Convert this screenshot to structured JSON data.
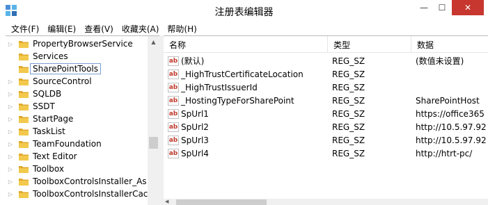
{
  "window": {
    "title": "注册表编辑器",
    "app_icon": "registry-editor-icon",
    "controls": {
      "minimize": "—",
      "maximize": "☐",
      "close": "✕"
    }
  },
  "menu": [
    "文件(F)",
    "编辑(E)",
    "查看(V)",
    "收藏夹(A)",
    "帮助(H)"
  ],
  "tree": {
    "items": [
      {
        "label": "PropertyBrowserService",
        "expandable": true,
        "selected": false
      },
      {
        "label": "Services",
        "expandable": false,
        "selected": false
      },
      {
        "label": "SharePointTools",
        "expandable": false,
        "selected": true
      },
      {
        "label": "SourceControl",
        "expandable": true,
        "selected": false
      },
      {
        "label": "SQLDB",
        "expandable": true,
        "selected": false
      },
      {
        "label": "SSDT",
        "expandable": true,
        "selected": false
      },
      {
        "label": "StartPage",
        "expandable": true,
        "selected": false
      },
      {
        "label": "TaskList",
        "expandable": true,
        "selected": false
      },
      {
        "label": "TeamFoundation",
        "expandable": true,
        "selected": false
      },
      {
        "label": "Text Editor",
        "expandable": true,
        "selected": false
      },
      {
        "label": "Toolbox",
        "expandable": true,
        "selected": false
      },
      {
        "label": "ToolboxControlsInstaller_As",
        "expandable": true,
        "selected": false
      },
      {
        "label": "ToolboxControlsInstallerCac",
        "expandable": true,
        "selected": false
      }
    ]
  },
  "list": {
    "columns": [
      "名称",
      "类型",
      "数据"
    ],
    "value_icon": "string-value-icon",
    "icon_text": "ab",
    "rows": [
      {
        "name": "(默认)",
        "type": "REG_SZ",
        "data": "(数值未设置)"
      },
      {
        "name": "_HighTrustCertificateLocation",
        "type": "REG_SZ",
        "data": ""
      },
      {
        "name": "_HighTrustIssuerId",
        "type": "REG_SZ",
        "data": ""
      },
      {
        "name": "_HostingTypeForSharePoint",
        "type": "REG_SZ",
        "data": "SharePointHost"
      },
      {
        "name": "SpUrl1",
        "type": "REG_SZ",
        "data": "https://office365"
      },
      {
        "name": "SpUrl2",
        "type": "REG_SZ",
        "data": "http://10.5.97.92"
      },
      {
        "name": "SpUrl3",
        "type": "REG_SZ",
        "data": "http://10.5.97.92"
      },
      {
        "name": "SpUrl4",
        "type": "REG_SZ",
        "data": "http://htrt-pc/"
      }
    ]
  },
  "colors": {
    "close_button": "#c7372f",
    "folder": "#f2c94c",
    "value_icon_text": "#c0392b",
    "selection_border": "#7a9cd3"
  }
}
